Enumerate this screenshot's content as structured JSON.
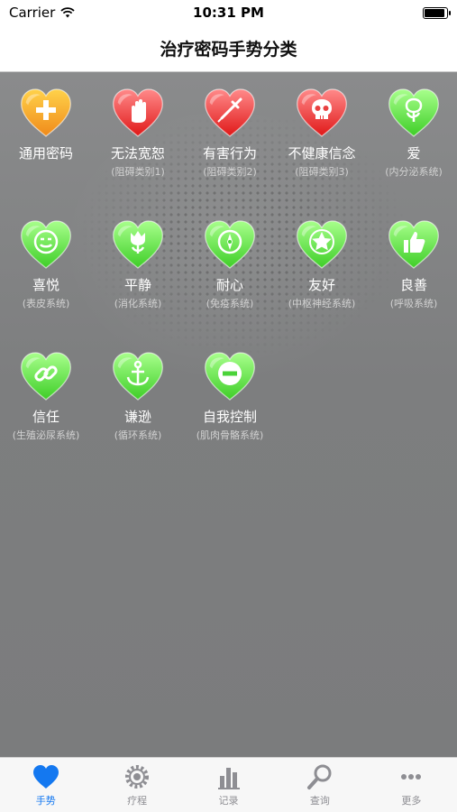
{
  "status_bar": {
    "carrier": "Carrier",
    "time": "10:31 PM"
  },
  "nav": {
    "title": "治疗密码手势分类"
  },
  "colors": {
    "orange": [
      "#ffd24a",
      "#f08a1a"
    ],
    "red": [
      "#ff8a8a",
      "#e01818"
    ],
    "green": [
      "#a8ff8c",
      "#3fce28"
    ],
    "tab_active": "#1478f0",
    "tab_inactive": "#8e8e93"
  },
  "grid": {
    "items": [
      {
        "label": "通用密码",
        "sub": "",
        "color": "orange",
        "icon": "plus-icon"
      },
      {
        "label": "无法宽恕",
        "sub": "(阻碍类别1)",
        "color": "red",
        "icon": "hand-icon"
      },
      {
        "label": "有害行为",
        "sub": "(阻碍类别2)",
        "color": "red",
        "icon": "syringe-icon"
      },
      {
        "label": "不健康信念",
        "sub": "(阻碍类别3)",
        "color": "red",
        "icon": "skull-icon"
      },
      {
        "label": "爱",
        "sub": "(内分泌系统)",
        "color": "green",
        "icon": "rose-icon"
      },
      {
        "label": "喜悦",
        "sub": "(表皮系统)",
        "color": "green",
        "icon": "smiley-icon"
      },
      {
        "label": "平静",
        "sub": "(消化系统)",
        "color": "green",
        "icon": "tulip-icon"
      },
      {
        "label": "耐心",
        "sub": "(免疫系统)",
        "color": "green",
        "icon": "compass-icon"
      },
      {
        "label": "友好",
        "sub": "(中枢神经系统)",
        "color": "green",
        "icon": "star-icon"
      },
      {
        "label": "良善",
        "sub": "(呼吸系统)",
        "color": "green",
        "icon": "thumbs-up-icon"
      },
      {
        "label": "信任",
        "sub": "(生殖泌尿系统)",
        "color": "green",
        "icon": "chain-link-icon"
      },
      {
        "label": "谦逊",
        "sub": "(循环系统)",
        "color": "green",
        "icon": "anchor-icon"
      },
      {
        "label": "自我控制",
        "sub": "(肌肉骨骼系统)",
        "color": "green",
        "icon": "minus-circle-icon"
      }
    ]
  },
  "tab_bar": {
    "tabs": [
      {
        "label": "手势",
        "icon": "heart-icon",
        "active": true
      },
      {
        "label": "疗程",
        "icon": "gear-icon",
        "active": false
      },
      {
        "label": "记录",
        "icon": "bar-chart-icon",
        "active": false
      },
      {
        "label": "查询",
        "icon": "magnifier-icon",
        "active": false
      },
      {
        "label": "更多",
        "icon": "ellipsis-icon",
        "active": false
      }
    ]
  }
}
